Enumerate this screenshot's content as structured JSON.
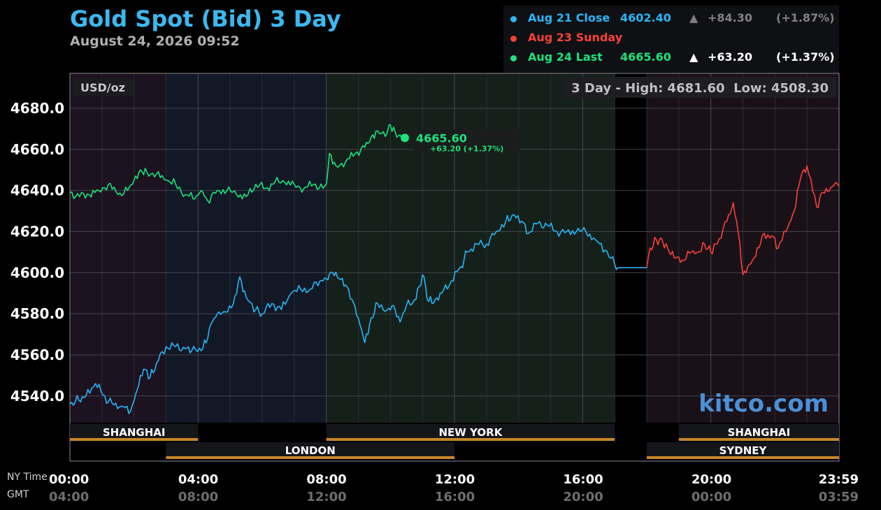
{
  "header": {
    "title": "Gold Spot (Bid) 3 Day",
    "subtitle": "August 24, 2026 09:52"
  },
  "legend": [
    {
      "label": "Aug 21 Close",
      "value": "4602.40",
      "arrow": "▲",
      "change": "+84.30",
      "pct": "(+1.87%)",
      "color": "#29b6f6",
      "dim": true
    },
    {
      "label": "Aug 23 Sunday",
      "value": "",
      "arrow": "",
      "change": "",
      "pct": "",
      "color": "#f44336",
      "dim": false
    },
    {
      "label": "Aug 24 Last",
      "value": "4665.60",
      "arrow": "▲",
      "change": "+63.20",
      "pct": "(+1.37%)",
      "color": "#1de27c",
      "dim": false
    }
  ],
  "panel": {
    "unit": "USD/oz",
    "range_text": "3 Day - High: 4681.60  Low: 4508.30",
    "watermark": "kitco.com",
    "last_value": "4665.60",
    "last_change": "+63.20 (+1.37%)"
  },
  "sessions": {
    "row1": [
      "SHANGHAI",
      "NEW YORK",
      "SHANGHAI"
    ],
    "row2": [
      "LONDON",
      "SYDNEY"
    ]
  },
  "footer": {
    "ny_label": "NY Time",
    "gmt_label": "GMT",
    "ny_times": [
      "00:00",
      "04:00",
      "08:00",
      "12:00",
      "16:00",
      "20:00",
      "23:59"
    ],
    "gmt_times": [
      "04:00",
      "08:00",
      "12:00",
      "16:00",
      "20:00",
      "00:00",
      "03:59"
    ]
  },
  "colors": {
    "friday": "#29b6f6",
    "sunday": "#f44336",
    "monday": "#1de27c",
    "session_bar": "#c8872a",
    "grid": "#3a3a40"
  },
  "chart_data": {
    "type": "line",
    "title": "Gold Spot (Bid) 3 Day",
    "ylabel": "USD/oz",
    "xlabel": "NY Time",
    "ylim": [
      4527,
      4697
    ],
    "xlim": [
      0,
      24
    ],
    "yticks": [
      "4680.0",
      "4660.0",
      "4640.0",
      "4620.0",
      "4600.0",
      "4580.0",
      "4560.0",
      "4540.0"
    ],
    "ytick_values": [
      4680,
      4660,
      4640,
      4620,
      4600,
      4580,
      4560,
      4540
    ],
    "high": 4681.6,
    "low": 4508.3,
    "series": [
      {
        "name": "Aug 21 Close",
        "color": "#29b6f6",
        "points": [
          [
            0,
            4536
          ],
          [
            0.5,
            4540
          ],
          [
            0.8,
            4546
          ],
          [
            1.2,
            4537
          ],
          [
            1.6,
            4535
          ],
          [
            1.9,
            4533
          ],
          [
            2.1,
            4543
          ],
          [
            2.3,
            4553
          ],
          [
            2.5,
            4549
          ],
          [
            2.7,
            4556
          ],
          [
            3.0,
            4564
          ],
          [
            3.3,
            4564
          ],
          [
            3.6,
            4563
          ],
          [
            3.8,
            4562
          ],
          [
            4.1,
            4562
          ],
          [
            4.3,
            4568
          ],
          [
            4.4,
            4575
          ],
          [
            4.6,
            4580
          ],
          [
            4.8,
            4581
          ],
          [
            5.1,
            4585
          ],
          [
            5.3,
            4598
          ],
          [
            5.5,
            4588
          ],
          [
            5.8,
            4582
          ],
          [
            6.0,
            4580
          ],
          [
            6.3,
            4585
          ],
          [
            6.6,
            4582
          ],
          [
            6.9,
            4590
          ],
          [
            7.2,
            4592
          ],
          [
            7.5,
            4592
          ],
          [
            7.8,
            4596
          ],
          [
            8.0,
            4597
          ],
          [
            8.2,
            4600
          ],
          [
            8.4,
            4597
          ],
          [
            8.6,
            4594
          ],
          [
            8.8,
            4587
          ],
          [
            9.0,
            4578
          ],
          [
            9.2,
            4566
          ],
          [
            9.4,
            4578
          ],
          [
            9.6,
            4585
          ],
          [
            9.9,
            4582
          ],
          [
            10.1,
            4584
          ],
          [
            10.3,
            4576
          ],
          [
            10.5,
            4584
          ],
          [
            10.8,
            4587
          ],
          [
            11.0,
            4599
          ],
          [
            11.2,
            4586
          ],
          [
            11.4,
            4587
          ],
          [
            11.6,
            4590
          ],
          [
            11.9,
            4596
          ],
          [
            12.2,
            4603
          ],
          [
            12.4,
            4610
          ],
          [
            12.7,
            4614
          ],
          [
            13.0,
            4614
          ],
          [
            13.3,
            4620
          ],
          [
            13.6,
            4625
          ],
          [
            13.8,
            4628
          ],
          [
            14.1,
            4625
          ],
          [
            14.3,
            4619
          ],
          [
            14.6,
            4624
          ],
          [
            14.9,
            4623
          ],
          [
            15.2,
            4620
          ],
          [
            15.5,
            4620
          ],
          [
            15.8,
            4620
          ],
          [
            16.1,
            4620
          ],
          [
            16.4,
            4616
          ],
          [
            16.7,
            4611
          ],
          [
            17.0,
            4604
          ],
          [
            17.1,
            4602.4
          ],
          [
            18.0,
            4602.4
          ]
        ]
      },
      {
        "name": "Aug 23 Sunday",
        "color": "#f44336",
        "points": [
          [
            18.0,
            4602.4
          ],
          [
            18.1,
            4612
          ],
          [
            18.3,
            4616
          ],
          [
            18.5,
            4615
          ],
          [
            18.7,
            4610
          ],
          [
            18.9,
            4607
          ],
          [
            19.1,
            4606
          ],
          [
            19.4,
            4610
          ],
          [
            19.6,
            4610
          ],
          [
            19.8,
            4614
          ],
          [
            20.0,
            4610
          ],
          [
            20.2,
            4614
          ],
          [
            20.5,
            4625
          ],
          [
            20.7,
            4634
          ],
          [
            20.9,
            4615
          ],
          [
            21.0,
            4599
          ],
          [
            21.2,
            4604
          ],
          [
            21.4,
            4608
          ],
          [
            21.6,
            4618
          ],
          [
            21.9,
            4618
          ],
          [
            22.1,
            4612
          ],
          [
            22.4,
            4622
          ],
          [
            22.6,
            4630
          ],
          [
            22.8,
            4646
          ],
          [
            23.0,
            4652
          ],
          [
            23.3,
            4632
          ],
          [
            23.5,
            4639
          ],
          [
            23.7,
            4640
          ],
          [
            23.9,
            4644
          ],
          [
            24.0,
            4642
          ]
        ]
      },
      {
        "name": "Aug 24 Last",
        "color": "#1de27c",
        "points": [
          [
            0,
            4639
          ],
          [
            0.3,
            4637
          ],
          [
            0.6,
            4638
          ],
          [
            0.9,
            4640
          ],
          [
            1.2,
            4643
          ],
          [
            1.5,
            4638
          ],
          [
            1.8,
            4640
          ],
          [
            2.0,
            4645
          ],
          [
            2.2,
            4650
          ],
          [
            2.4,
            4649
          ],
          [
            2.7,
            4648
          ],
          [
            3.0,
            4645
          ],
          [
            3.3,
            4643
          ],
          [
            3.6,
            4638
          ],
          [
            3.9,
            4636
          ],
          [
            4.1,
            4640
          ],
          [
            4.3,
            4635
          ],
          [
            4.6,
            4640
          ],
          [
            4.9,
            4640
          ],
          [
            5.2,
            4638
          ],
          [
            5.5,
            4637
          ],
          [
            5.8,
            4643
          ],
          [
            6.1,
            4641
          ],
          [
            6.4,
            4644
          ],
          [
            6.7,
            4644
          ],
          [
            7.0,
            4643
          ],
          [
            7.3,
            4641
          ],
          [
            7.6,
            4643
          ],
          [
            7.9,
            4641
          ],
          [
            8.0,
            4643
          ],
          [
            8.1,
            4658
          ],
          [
            8.3,
            4652
          ],
          [
            8.6,
            4654
          ],
          [
            8.9,
            4658
          ],
          [
            9.2,
            4661
          ],
          [
            9.4,
            4666
          ],
          [
            9.6,
            4669
          ],
          [
            9.9,
            4668
          ],
          [
            10.0,
            4672
          ],
          [
            10.2,
            4666
          ],
          [
            10.3,
            4667
          ],
          [
            10.45,
            4665.6
          ]
        ]
      }
    ]
  }
}
